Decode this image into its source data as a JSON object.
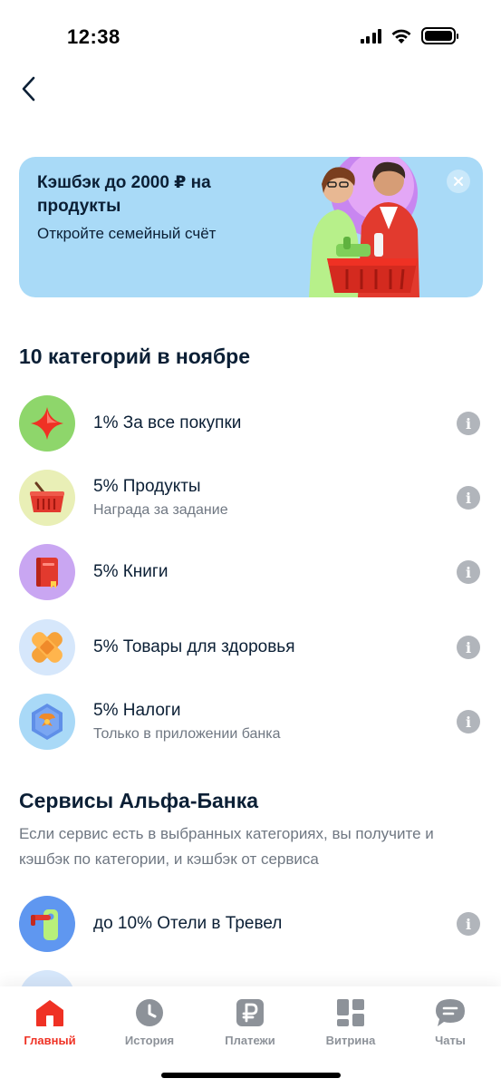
{
  "status": {
    "time": "12:38"
  },
  "banner": {
    "title": "Кэшбэк до 2000 ₽ на продукты",
    "subtitle": "Откройте семейный счёт"
  },
  "categories_section": {
    "title": "10 категорий в ноябре",
    "items": [
      {
        "title": "1% За все покупки",
        "subtitle": "",
        "icon": "star-icon",
        "color": "#8ed66b"
      },
      {
        "title": "5% Продукты",
        "subtitle": "Награда за задание",
        "icon": "basket-icon",
        "color": "#e9efb6"
      },
      {
        "title": "5% Книги",
        "subtitle": "",
        "icon": "book-icon",
        "color": "#c9a6f2"
      },
      {
        "title": "5% Товары для здоровья",
        "subtitle": "",
        "icon": "bandage-icon",
        "color": "#d6e7fb"
      },
      {
        "title": "5% Налоги",
        "subtitle": "Только в приложении банка",
        "icon": "emblem-icon",
        "color": "#a9d9f7"
      }
    ]
  },
  "services_section": {
    "title": "Сервисы Альфа-Банка",
    "description": "Если сервис есть в выбранных категориях, вы получите и кэшбэк по категории, и кэшбэк от сервиса",
    "items": [
      {
        "title": "до 10% Отели в Тревел",
        "icon": "door-key-icon",
        "color": "#5f97f0"
      }
    ]
  },
  "tabbar": {
    "tabs": [
      {
        "label": "Главный",
        "icon": "home-icon",
        "active": true
      },
      {
        "label": "История",
        "icon": "clock-icon",
        "active": false
      },
      {
        "label": "Платежи",
        "icon": "ruble-icon",
        "active": false
      },
      {
        "label": "Витрина",
        "icon": "grid-icon",
        "active": false
      },
      {
        "label": "Чаты",
        "icon": "chat-icon",
        "active": false
      }
    ]
  },
  "colors": {
    "accent": "#ef3124",
    "banner_bg": "#a9daf7",
    "text_primary": "#0b1f35",
    "text_secondary": "#6f7782"
  }
}
